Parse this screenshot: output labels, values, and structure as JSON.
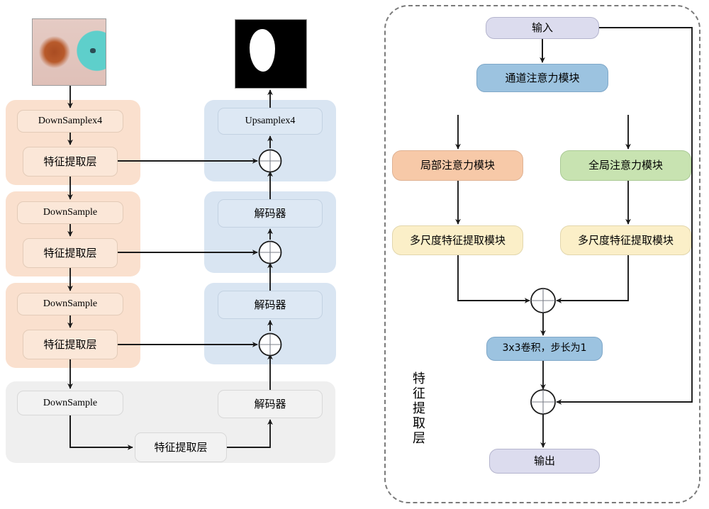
{
  "figure": {
    "type": "architecture-diagram",
    "left_network": {
      "title": "U-shaped encoder-decoder segmentation network",
      "input_image": {
        "name": "dermoscopy-input-image",
        "alt": "skin lesion dermoscopy photo"
      },
      "output_image": {
        "name": "segmentation-mask-image",
        "alt": "binary lesion segmentation mask"
      },
      "encoder_stages": [
        {
          "downsample": "DownSamplex4",
          "feature": "特征提取层"
        },
        {
          "downsample": "DownSample",
          "feature": "特征提取层"
        },
        {
          "downsample": "DownSample",
          "feature": "特征提取层"
        }
      ],
      "bottleneck": {
        "downsample": "DownSample",
        "feature": "特征提取层",
        "decoder": "解码器"
      },
      "decoder_stages": [
        {
          "label": "Upsamplex4"
        },
        {
          "label": "解码器"
        },
        {
          "label": "解码器"
        }
      ],
      "merge_symbol": "+"
    },
    "right_module": {
      "caption": "特征提取层",
      "input": "输入",
      "channel_attention": "通道注意力模块",
      "local_attention": "局部注意力模块",
      "global_attention": "全局注意力模块",
      "multiscale_left": "多尺度特征提取模块",
      "multiscale_right": "多尺度特征提取模块",
      "conv": "3x3卷积，步长为1",
      "output": "输出",
      "merge_symbol": "+"
    },
    "colors": {
      "encoder_group": "#fae0ce",
      "decoder_group": "#d9e5f2",
      "bottleneck_group": "#efefef",
      "input_output_node": "#dcdcee",
      "channel_attention_node": "#9cc3e0",
      "local_attention_node": "#f7c9a8",
      "global_attention_node": "#c8e3b1",
      "multiscale_node": "#fbefc8",
      "conv_node": "#9cc3e0",
      "arrow": "#1a1a1a",
      "panel_border": "#7a7a7a"
    }
  }
}
